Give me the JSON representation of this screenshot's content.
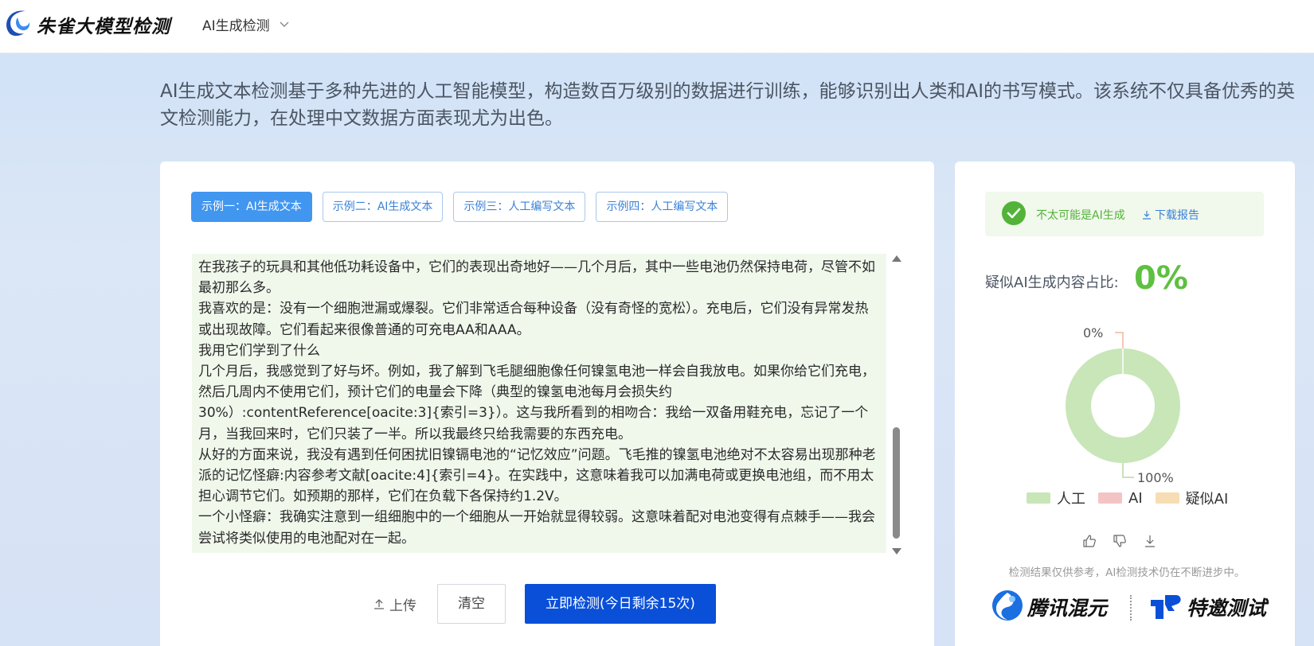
{
  "header": {
    "brand": "朱雀大模型检测",
    "nav_label": "AI生成检测"
  },
  "intro": "AI生成文本检测基于多种先进的人工智能模型，构造数百万级别的数据进行训练，能够识别出人类和AI的书写模式。该系统不仅具备优秀的英文检测能力，在处理中文数据方面表现尤为出色。",
  "tabs": [
    {
      "label": "示例一：AI生成文本",
      "active": true
    },
    {
      "label": "示例二：AI生成文本",
      "active": false
    },
    {
      "label": "示例三：人工编写文本",
      "active": false
    },
    {
      "label": "示例四：人工编写文本",
      "active": false
    }
  ],
  "text_lines": [
    "在我孩子的玩具和其他低功耗设备中，它们的表现出奇地好——几个月后，其中一些电池仍然保持电荷，尽管不如最初那么多。",
    "我喜欢的是：没有一个细胞泄漏或爆裂。它们非常适合每种设备（没有奇怪的宽松）。充电后，它们没有异常发热或出现故障。它们看起来很像普通的可充电AA和AAA。",
    "我用它们学到了什么",
    "几个月后，我感觉到了好与坏。例如，我了解到飞毛腿细胞像任何镍氢电池一样会自我放电。如果你给它们充电，然后几周内不使用它们，预计它们的电量会下降（典型的镍氢电池每月会损失约30%）:contentReference[oacite:3]{索引=3}）。这与我所看到的相吻合：我给一双备用鞋充电，忘记了一个月，当我回来时，它们只装了一半。所以我最终只给我需要的东西充电。",
    "从好的方面来说，我没有遇到任何困扰旧镍镉电池的“记忆效应”问题。飞毛推的镍氢电池绝对不太容易出现那种老派的记忆怪癖:内容参考文献[oacite:4]{索引=4}。在实践中，这意味着我可以加满电荷或更换电池组，而不用太担心调节它们。如预期的那样，它们在负载下各保持约1.2V。",
    "一个小怪癖：我确实注意到一组细胞中的一个细胞从一开始就显得较弱。这意味着配对电池变得有点棘手——我会尝试将类似使用的电池配对在一起。"
  ],
  "actions": {
    "upload": "上传",
    "clear": "清空",
    "detect": "立即检测(今日剩余15次)"
  },
  "result": {
    "verdict": "不太可能是AI生成",
    "download": "下载报告",
    "ratio_label": "疑似AI生成内容占比:",
    "ratio_value": "0%"
  },
  "chart_data": {
    "type": "pie",
    "variant": "donut",
    "categories": [
      "人工",
      "AI",
      "疑似AI"
    ],
    "values": [
      100,
      0,
      0
    ],
    "labels": [
      "100%",
      "0%"
    ],
    "colors": [
      "#c8e6b7",
      "#f4c4c4",
      "#f8dcb4"
    ],
    "legend": "bottom"
  },
  "disclaimer": "检测结果仅供参考，AI检测技术仍在不断进步中。",
  "partners": [
    "腾讯混元",
    "特邀测试"
  ],
  "icons": {
    "logo": "zhuque-logo-icon",
    "chevron": "chevron-down-icon",
    "check": "check-circle-icon",
    "download": "download-icon",
    "upload": "upload-icon",
    "thumbs_up": "thumbs-up-icon",
    "thumbs_down": "thumbs-down-icon"
  },
  "colors": {
    "accent": "#0a4fd8",
    "tab_active": "#4196f0",
    "success": "#52b338",
    "text_bg": "#f0f8ec"
  }
}
